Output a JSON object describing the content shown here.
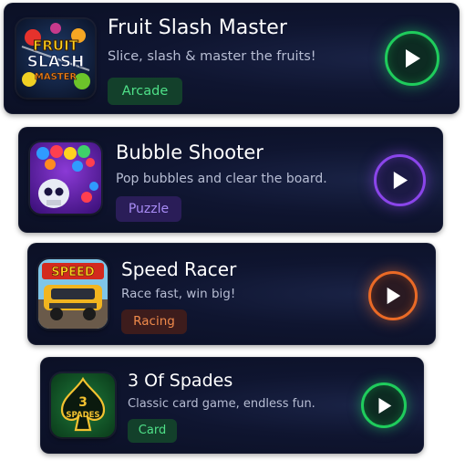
{
  "games": [
    {
      "title": "Fruit Slash Master",
      "description": "Slice, slash & master the fruits!",
      "category": "Arcade",
      "icon_text": [
        "FRUIT",
        "SLASH",
        "MASTER"
      ],
      "icon": "fruit-slash-game-icon",
      "accent": "#1fcc5c"
    },
    {
      "title": "Bubble Shooter",
      "description": "Pop bubbles and clear the board.",
      "category": "Puzzle",
      "icon": "bubble-shooter-game-icon",
      "accent": "#8a45ea"
    },
    {
      "title": "Speed Racer",
      "description": "Race fast, win big!",
      "category": "Racing",
      "icon_text": [
        "SPEED"
      ],
      "icon": "speed-racer-game-icon",
      "accent": "#ea6a26"
    },
    {
      "title": "3 Of Spades",
      "description": "Classic card game, endless fun.",
      "category": "Card",
      "icon_text": [
        "3",
        "SPADES"
      ],
      "icon": "spade-card-game-icon",
      "accent": "#1fcc5c"
    }
  ],
  "play_icon": "play-icon"
}
